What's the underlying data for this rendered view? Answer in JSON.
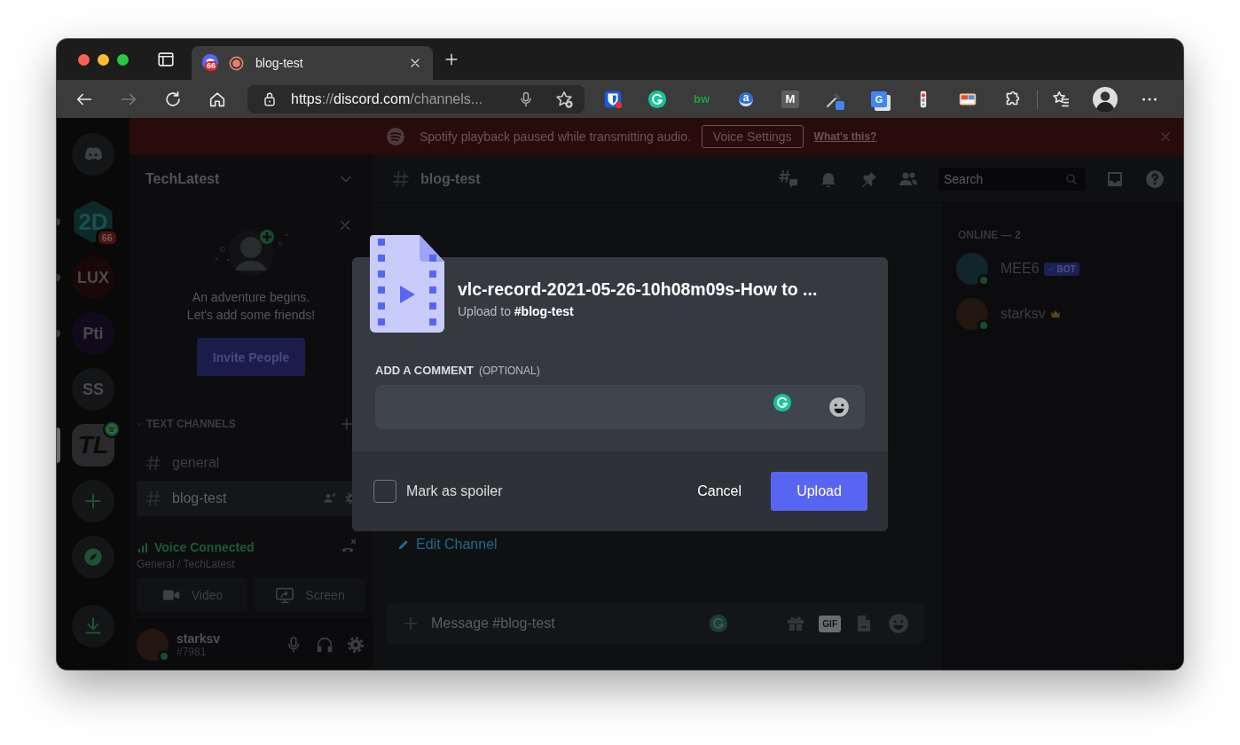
{
  "browser": {
    "tabs": [
      {
        "title": "blog-test",
        "badge": "66",
        "selected": true
      }
    ],
    "nav_buttons": [
      {
        "kind": "back",
        "disabled": false
      },
      {
        "kind": "forward",
        "disabled": true
      },
      {
        "kind": "reload",
        "disabled": false
      },
      {
        "kind": "home",
        "disabled": false
      }
    ],
    "address": {
      "parts": [
        {
          "text": "https",
          "kind": "strong"
        },
        {
          "text": "://",
          "kind": "dim"
        },
        {
          "text": "discord.com",
          "kind": "strong"
        },
        {
          "text": "/channels...",
          "kind": "dim"
        }
      ]
    },
    "extensions": [
      {
        "kind": "shield"
      },
      {
        "kind": "grammarly"
      },
      {
        "kind": "wordmark",
        "label": "bw"
      },
      {
        "kind": "pin-badge",
        "label": "a"
      },
      {
        "kind": "tile",
        "label": "M"
      },
      {
        "kind": "eyedropper"
      },
      {
        "kind": "translate",
        "label": "G"
      },
      {
        "kind": "traffic-light"
      },
      {
        "kind": "palette"
      },
      {
        "kind": "puzzle"
      }
    ]
  },
  "notice": {
    "text": "Spotify playback paused while transmitting audio.",
    "button": "Voice Settings",
    "link": "What's this?"
  },
  "servers": [
    {
      "kind": "home",
      "selected": false,
      "unread": false
    },
    {
      "kind": "hex",
      "label": "2D",
      "badge": "66",
      "color": "#0d2a2a",
      "selected": false,
      "unread": true
    },
    {
      "kind": "guild",
      "label": "LUX",
      "color": "#1a0707",
      "selected": false,
      "unread": true
    },
    {
      "kind": "guild",
      "label": "Pti",
      "color": "#120a1c",
      "selected": false,
      "unread": true
    },
    {
      "kind": "guild",
      "label": "SS",
      "color": "#141517",
      "selected": false,
      "unread": false
    },
    {
      "kind": "tile",
      "label": "TL",
      "color": "#2a2a2c",
      "speaking": true,
      "selected": true,
      "unread": false
    },
    {
      "kind": "add",
      "selected": false,
      "unread": false
    },
    {
      "kind": "explore",
      "selected": false,
      "unread": false
    },
    {
      "kind": "download",
      "selected": false,
      "unread": false
    }
  ],
  "server_name": "TechLatest",
  "welcome": {
    "lines": [
      "An adventure begins.",
      "Let's add some friends!"
    ],
    "button": "Invite People"
  },
  "channel_category": "TEXT CHANNELS",
  "channels": [
    {
      "name": "general",
      "selected": false
    },
    {
      "name": "blog-test",
      "selected": true
    }
  ],
  "voice": {
    "status": "Voice Connected",
    "location": "General / TechLatest",
    "buttons": [
      {
        "kind": "video",
        "label": "Video"
      },
      {
        "kind": "screen",
        "label": "Screen"
      }
    ]
  },
  "user": {
    "name": "starksv",
    "tag": "#7981",
    "online": true
  },
  "channel_header": {
    "name": "blog-test",
    "search_placeholder": "Search"
  },
  "chat": {
    "edit_link": "Edit Channel",
    "message_placeholder": "Message #blog-test",
    "gif_label": "GIF"
  },
  "members": {
    "heading": "ONLINE — 2",
    "list": [
      {
        "name": "MEE6",
        "online": true,
        "bot_tag": "BOT",
        "owner": false,
        "color": "#10262c"
      },
      {
        "name": "starksv",
        "online": true,
        "owner": true,
        "color": "#22160f"
      }
    ]
  },
  "upload_dialog": {
    "file_name": "vlc-record-2021-05-26-10h08m09s-How to ...",
    "destination": "Upload to **#blog-test**",
    "comment_label": "ADD A COMMENT",
    "comment_hint": "(OPTIONAL)",
    "spoiler": {
      "label": "Mark as spoiler",
      "checked": false
    },
    "buttons": [
      {
        "kind": "secondary",
        "label": "Cancel"
      },
      {
        "kind": "primary",
        "label": "Upload"
      }
    ]
  }
}
